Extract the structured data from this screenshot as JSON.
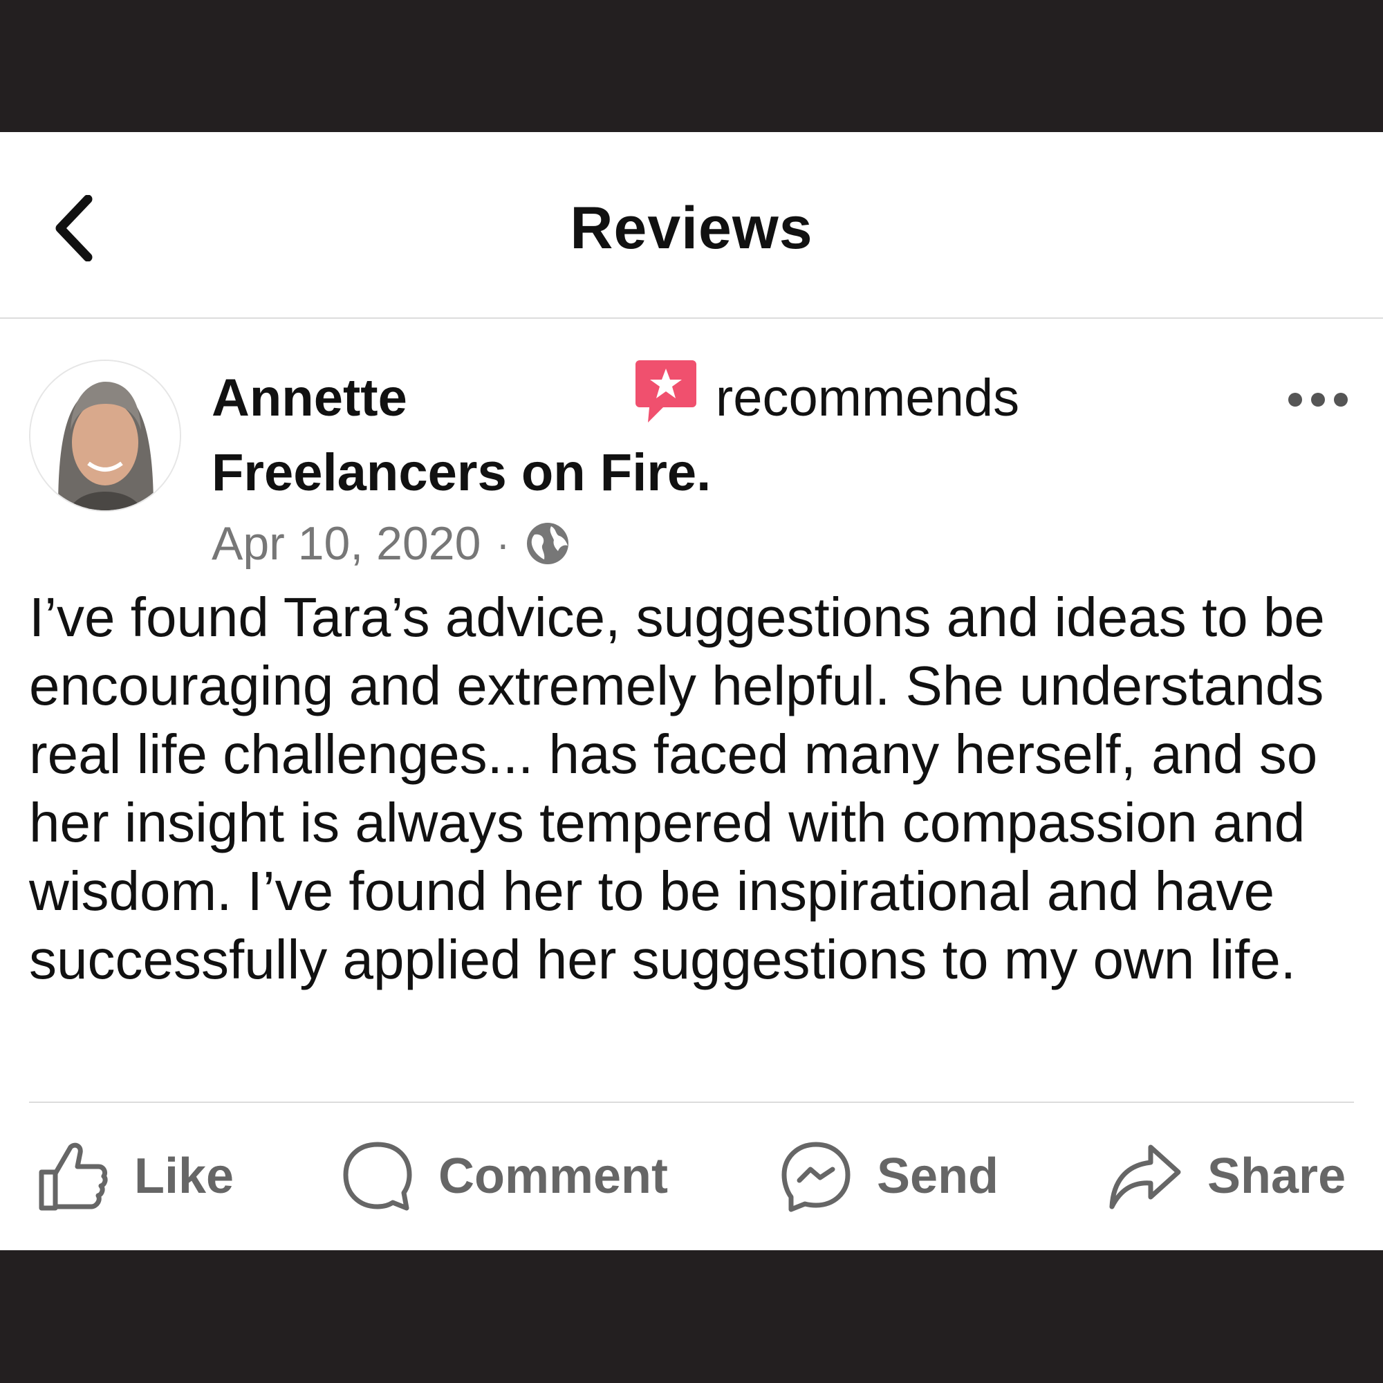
{
  "header": {
    "title": "Reviews",
    "back_icon": "chevron-left-icon"
  },
  "post": {
    "author": "Annette",
    "recommends_icon": "recommend-star-icon",
    "recommends_color": "#f0506e",
    "verb": "recommends",
    "page_name": "Freelancers on Fire.",
    "date": "Apr 10, 2020",
    "separator": "·",
    "privacy_icon": "globe-icon",
    "more_icon": "more-dots-icon",
    "text": "I’ve found Tara’s advice, suggestions and ideas to be encouraging and extremely helpful. She understands real life challenges... has faced many herself, and so her insight is always tempered with compassion and wisdom. I’ve found her to be inspirational and have successfully applied her suggestions to my own life."
  },
  "actions": {
    "like": "Like",
    "comment": "Comment",
    "send": "Send",
    "share": "Share"
  }
}
